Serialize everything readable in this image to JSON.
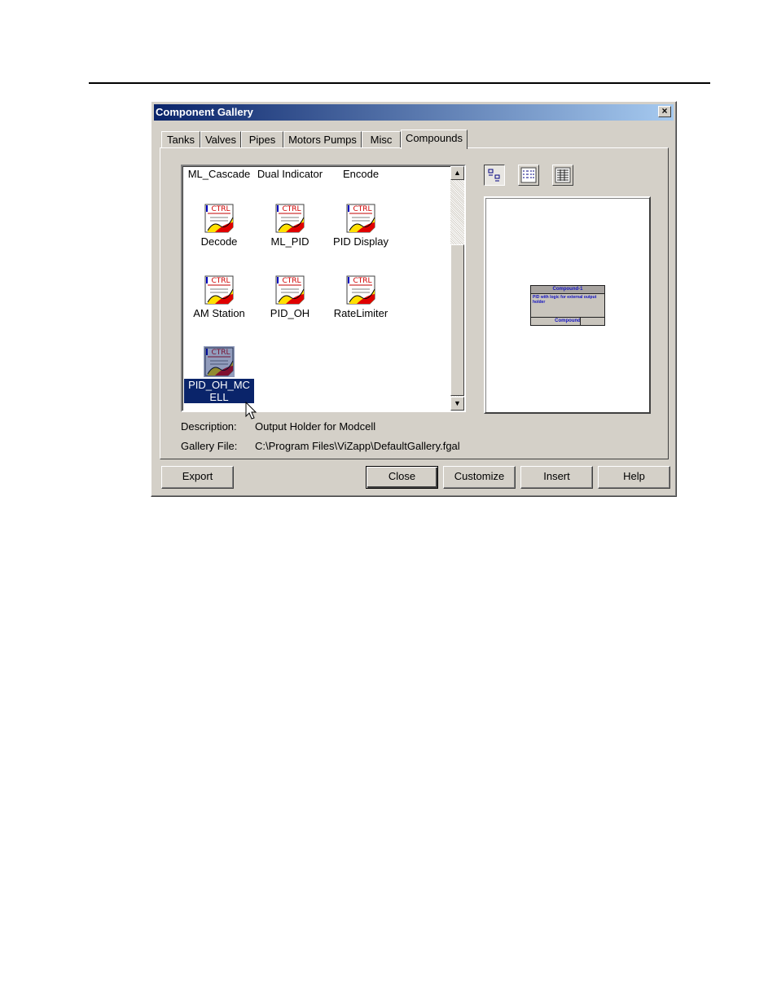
{
  "window": {
    "title": "Component Gallery",
    "close_label": "×"
  },
  "tabs": [
    {
      "label": "Tanks"
    },
    {
      "label": "Valves"
    },
    {
      "label": "Pipes"
    },
    {
      "label": "Motors  Pumps"
    },
    {
      "label": "Misc"
    },
    {
      "label": "Compounds",
      "active": true
    }
  ],
  "gallery": {
    "items": [
      {
        "label": "ML_Cascade"
      },
      {
        "label": "Dual Indicator"
      },
      {
        "label": "Encode"
      },
      {
        "label": "Decode",
        "icon": "ctrl-icon"
      },
      {
        "label": "ML_PID",
        "icon": "ctrl-icon"
      },
      {
        "label": "PID Display",
        "icon": "ctrl-icon"
      },
      {
        "label": "AM Station",
        "icon": "ctrl-icon"
      },
      {
        "label": "PID_OH",
        "icon": "ctrl-icon"
      },
      {
        "label": "RateLimiter",
        "icon": "ctrl-icon"
      },
      {
        "label": "PID_OH_MCELL",
        "icon": "ctrl-icon",
        "selected": true
      }
    ],
    "icon_text": "CTRL",
    "scroll_up": "▲",
    "scroll_down": "▼"
  },
  "view_buttons": [
    {
      "name": "large-icons-view-icon",
      "pressed": true
    },
    {
      "name": "list-view-icon"
    },
    {
      "name": "details-view-icon"
    }
  ],
  "preview": {
    "header": "Compound-1",
    "body": "PID with logic for external output holder",
    "footer": "Compound"
  },
  "info": {
    "description_label": "Description:",
    "description_value": "Output Holder for Modcell",
    "file_label": "Gallery File:",
    "file_value": "C:\\Program Files\\ViZapp\\DefaultGallery.fgal"
  },
  "buttons": {
    "export": "Export",
    "close": "Close",
    "customize": "Customize",
    "insert": "Insert",
    "help": "Help"
  },
  "colors": {
    "selection": "#0a246a",
    "title_gradient_start": "#0a246a",
    "title_gradient_end": "#a6caf0",
    "face": "#d4d0c8"
  }
}
